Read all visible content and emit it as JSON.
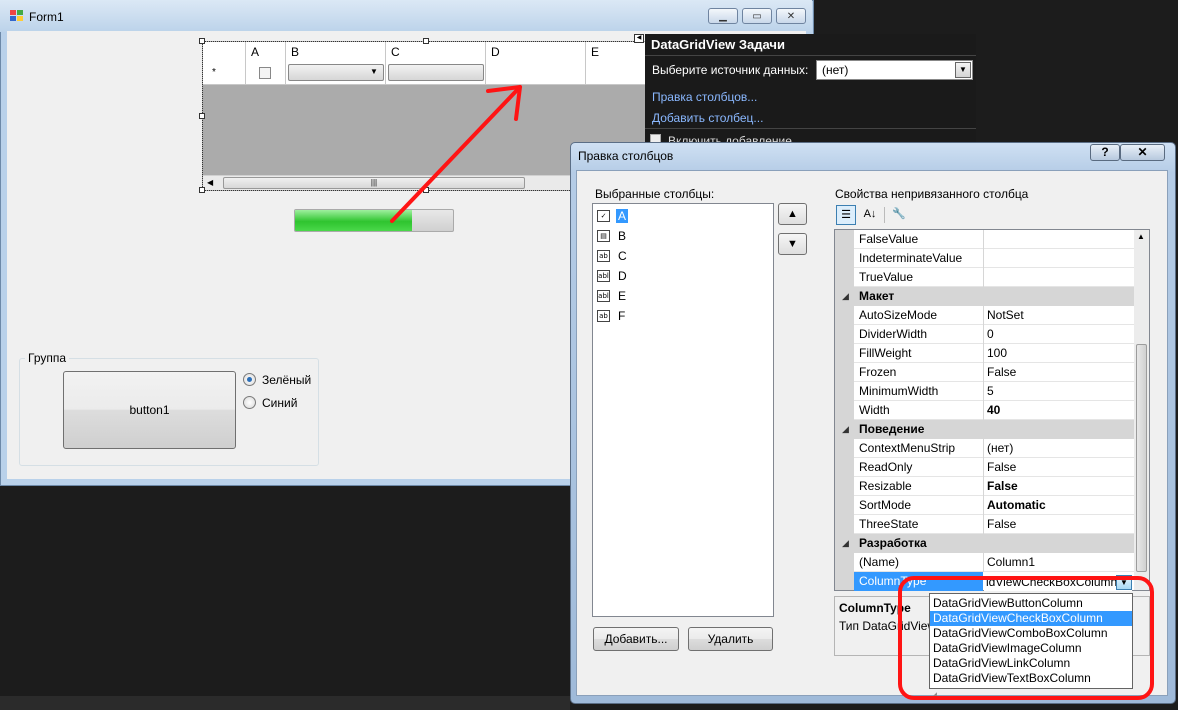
{
  "form1": {
    "title": "Form1",
    "grid": {
      "columns": [
        "A",
        "B",
        "C",
        "D",
        "E"
      ],
      "new_row_marker": "*"
    },
    "progress": {
      "value_percent": 74
    },
    "group": {
      "label": "Группа",
      "button_label": "button1",
      "radio_green": "Зелёный",
      "radio_blue": "Синий"
    }
  },
  "smart_tag": {
    "title": "DataGridView Задачи",
    "datasource_label": "Выберите источник данных:",
    "datasource_value": "(нет)",
    "edit_columns": "Правка столбцов...",
    "add_column": "Добавить столбец...",
    "enable_adding": "Включить добавление"
  },
  "dialog": {
    "title": "Правка столбцов",
    "help": "?",
    "selected_label": "Выбранные столбцы:",
    "columns": [
      {
        "name": "A",
        "icon": "checkbox-column-icon",
        "glyph": "✓"
      },
      {
        "name": "B",
        "icon": "combobox-column-icon",
        "glyph": "▤"
      },
      {
        "name": "C",
        "icon": "textbox-column-icon",
        "glyph": "ab"
      },
      {
        "name": "D",
        "icon": "textbox-column-icon",
        "glyph": "abl"
      },
      {
        "name": "E",
        "icon": "textbox-column-icon",
        "glyph": "abl"
      },
      {
        "name": "F",
        "icon": "textbox-column-icon",
        "glyph": "ab"
      }
    ],
    "add_button": "Добавить...",
    "remove_button": "Удалить",
    "props_label": "Свойства непривязанного столбца",
    "properties": [
      {
        "name": "FalseValue",
        "value": ""
      },
      {
        "name": "IndeterminateValue",
        "value": ""
      },
      {
        "name": "TrueValue",
        "value": ""
      },
      {
        "category": "Макет"
      },
      {
        "name": "AutoSizeMode",
        "value": "NotSet"
      },
      {
        "name": "DividerWidth",
        "value": "0"
      },
      {
        "name": "FillWeight",
        "value": "100"
      },
      {
        "name": "Frozen",
        "value": "False"
      },
      {
        "name": "MinimumWidth",
        "value": "5"
      },
      {
        "name": "Width",
        "value": "40",
        "bold": true
      },
      {
        "category": "Поведение"
      },
      {
        "name": "ContextMenuStrip",
        "value": "(нет)"
      },
      {
        "name": "ReadOnly",
        "value": "False"
      },
      {
        "name": "Resizable",
        "value": "False",
        "bold": true
      },
      {
        "name": "SortMode",
        "value": "Automatic",
        "bold": true
      },
      {
        "name": "ThreeState",
        "value": "False"
      },
      {
        "category": "Разработка"
      },
      {
        "name": "(Name)",
        "value": "Column1"
      },
      {
        "name": "ColumnType",
        "value": "idViewCheckBoxColumn",
        "selected": true
      }
    ],
    "description_title": "ColumnType",
    "description_text": "Тип DataGridView",
    "column_type_options": [
      "DataGridViewButtonColumn",
      "DataGridViewCheckBoxColumn",
      "DataGridViewComboBoxColumn",
      "DataGridViewImageColumn",
      "DataGridViewLinkColumn",
      "DataGridViewTextBoxColumn"
    ],
    "column_type_selected_index": 1
  },
  "annotation_colors": {
    "arrow": "#ff1414",
    "highlight_box": "#ff1414"
  }
}
